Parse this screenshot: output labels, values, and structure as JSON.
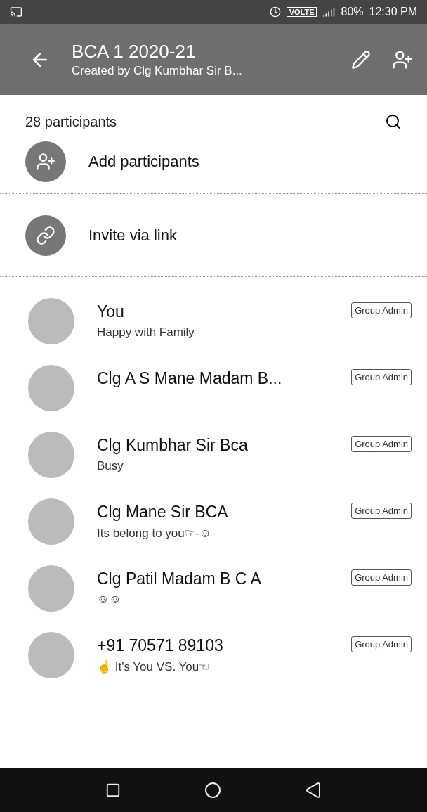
{
  "status_bar": {
    "indicators": "VOLTE",
    "battery": "80%",
    "time": "12:30 PM"
  },
  "header": {
    "title": "BCA 1 2020-21",
    "subtitle": "Created by Clg Kumbhar Sir B..."
  },
  "participants_count": "28 participants",
  "actions": [
    {
      "kind": "add",
      "label": "Add participants"
    },
    {
      "kind": "link",
      "label": "Invite via link"
    }
  ],
  "participants": [
    {
      "name": "You",
      "status": "Happy with Family",
      "badge": "Group Admin"
    },
    {
      "name": "Clg A S Mane Madam B...",
      "badge": "Group Admin"
    },
    {
      "name": "Clg Kumbhar Sir Bca",
      "status": "Busy",
      "badge": "Group Admin"
    },
    {
      "name": "Clg Mane Sir BCA",
      "status": "Its belong to you☞-☺",
      "badge": "Group Admin"
    },
    {
      "name": "Clg Patil Madam B C A",
      "status": "☺☺",
      "badge": "Group Admin"
    },
    {
      "name": "+91 70571 89103",
      "status": "☝ It's You  VS. You☜",
      "badge": "Group Admin"
    }
  ]
}
